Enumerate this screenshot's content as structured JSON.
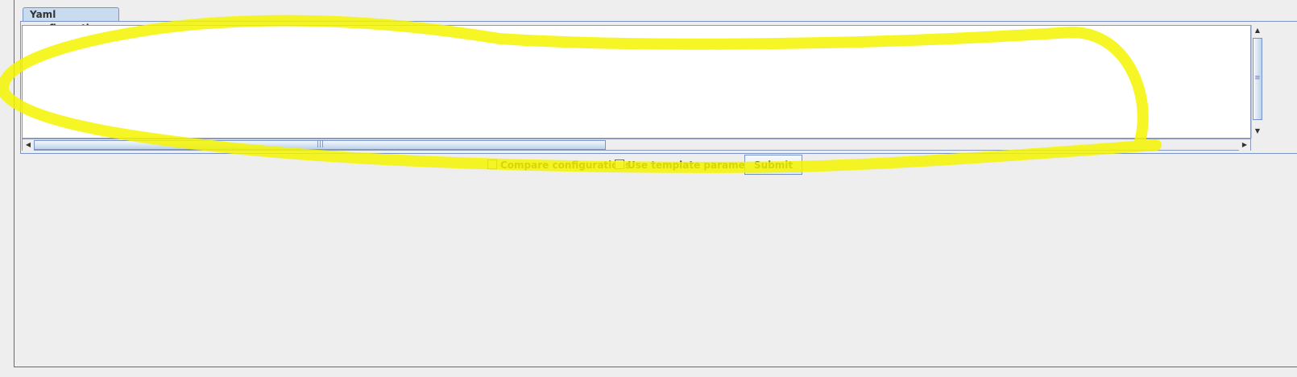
{
  "tab": {
    "label": "Yaml configuration"
  },
  "editor": {
    "value": ""
  },
  "controls": {
    "compare_label": "Compare configurations",
    "compare_checked": false,
    "template_label": "Use template parameters",
    "template_checked": false,
    "submit_label": "Submit"
  },
  "annotation": {
    "color": "#f5f500"
  }
}
